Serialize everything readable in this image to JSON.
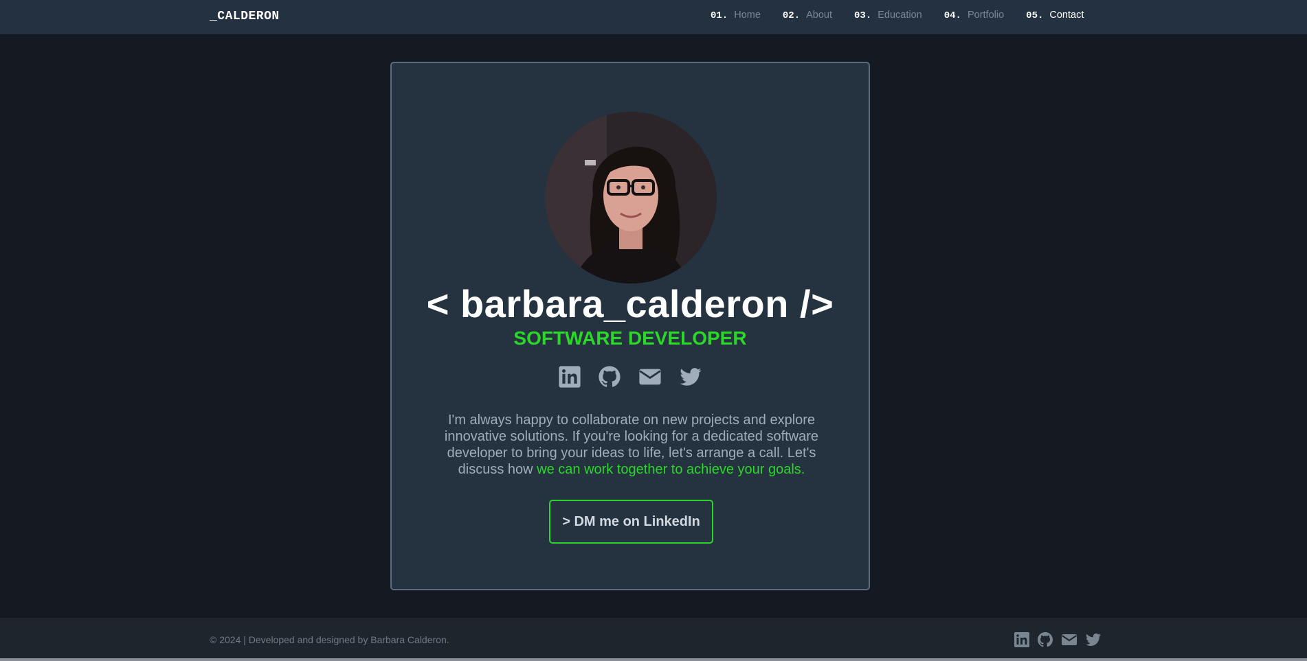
{
  "brand": "_CALDERON",
  "nav": [
    {
      "num": "01.",
      "label": "Home"
    },
    {
      "num": "02.",
      "label": "About"
    },
    {
      "num": "03.",
      "label": "Education"
    },
    {
      "num": "04.",
      "label": "Portfolio"
    },
    {
      "num": "05.",
      "label": "Contact",
      "active": true
    }
  ],
  "hero": {
    "title": "< barbara_calderon />",
    "subtitle": "SOFTWARE DEVELOPER",
    "bio_text": "I'm always happy to collaborate on new projects and explore innovative solutions. If you're looking for a dedicated software developer to bring your ideas to life, let's arrange a call. Let's discuss how ",
    "bio_highlight": "we can work together to achieve your goals.",
    "cta_label": "> DM me on LinkedIn",
    "socials": [
      "linkedin-icon",
      "github-icon",
      "envelope-icon",
      "twitter-icon"
    ]
  },
  "footer": {
    "copyright": "© 2024 | Developed and designed by Barbara Calderon.",
    "socials": [
      "linkedin-icon",
      "github-icon",
      "envelope-icon",
      "twitter-icon"
    ]
  },
  "colors": {
    "accent": "#2bd727",
    "background": "#151a22",
    "card": "#253341",
    "navbar": "#243140",
    "muted_text": "#a0acb9"
  }
}
